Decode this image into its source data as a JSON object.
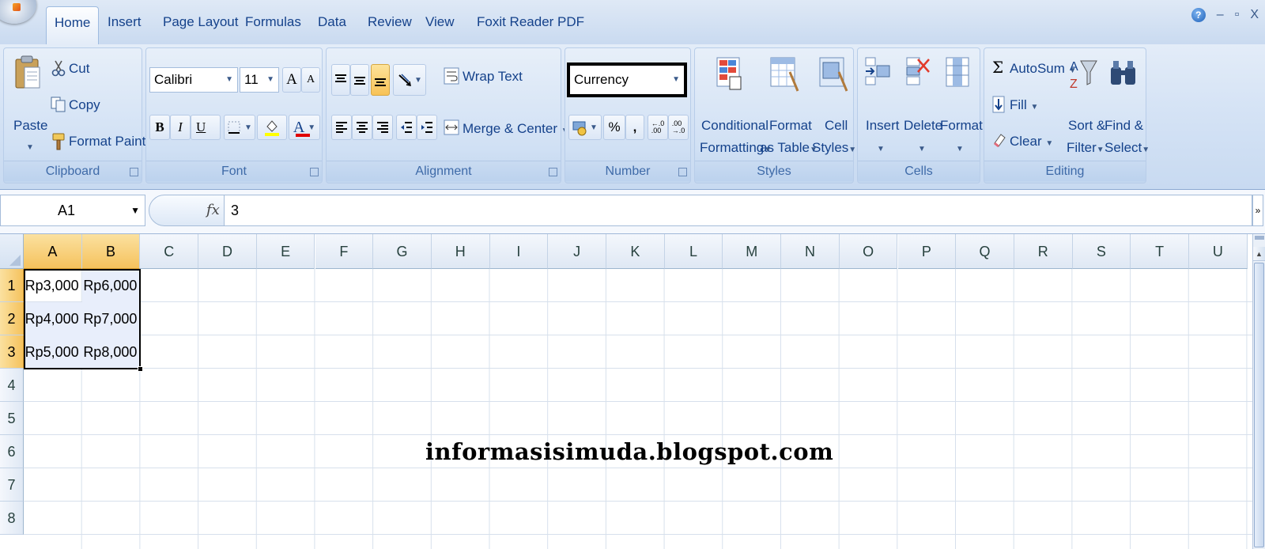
{
  "tabs": [
    {
      "label": "Home",
      "active": true
    },
    {
      "label": "Insert"
    },
    {
      "label": "Page Layout"
    },
    {
      "label": "Formulas"
    },
    {
      "label": "Data"
    },
    {
      "label": "Review"
    },
    {
      "label": "View"
    },
    {
      "label": "Foxit Reader PDF"
    }
  ],
  "window_controls": {
    "help": "?",
    "minimize": "–",
    "restore": "▫",
    "close": "X"
  },
  "clipboard": {
    "group_label": "Clipboard",
    "paste": "Paste",
    "cut": "Cut",
    "copy": "Copy",
    "format_painter": "Format Painter"
  },
  "font": {
    "group_label": "Font",
    "font_name": "Calibri",
    "font_size": "11",
    "grow": "A",
    "shrink": "A",
    "bold": "B",
    "italic": "I",
    "underline": "U",
    "font_color_glyph": "A",
    "fill_color": "#ffff00",
    "font_color": "#e00000"
  },
  "alignment": {
    "group_label": "Alignment",
    "wrap_text": "Wrap Text",
    "merge_center": "Merge & Center"
  },
  "number": {
    "group_label": "Number",
    "format": "Currency",
    "percent": "%",
    "comma": ","
  },
  "styles": {
    "group_label": "Styles",
    "conditional": [
      "Conditional",
      "Formatting"
    ],
    "format_table": [
      "Format",
      "as Table"
    ],
    "cell_styles": [
      "Cell",
      "Styles"
    ]
  },
  "cells_group": {
    "group_label": "Cells",
    "insert": "Insert",
    "delete": "Delete",
    "format": "Format"
  },
  "editing": {
    "group_label": "Editing",
    "autosum": "AutoSum",
    "fill": "Fill",
    "clear": "Clear",
    "sort_filter": [
      "Sort &",
      "Filter"
    ],
    "find_select": [
      "Find &",
      "Select"
    ]
  },
  "formula_bar": {
    "name_box": "A1",
    "fx": "fx",
    "formula": "3"
  },
  "grid": {
    "columns": [
      "A",
      "B",
      "C",
      "D",
      "E",
      "F",
      "G",
      "H",
      "I",
      "J",
      "K",
      "L",
      "M",
      "N",
      "O",
      "P",
      "Q",
      "R",
      "S",
      "T",
      "U"
    ],
    "rows": [
      "1",
      "2",
      "3",
      "4",
      "5",
      "6",
      "7",
      "8"
    ],
    "cells": [
      [
        "Rp3,000",
        "Rp6,000"
      ],
      [
        "Rp4,000",
        "Rp7,000"
      ],
      [
        "Rp5,000",
        "Rp8,000"
      ]
    ],
    "selected_range": "A1:B3"
  },
  "watermark": "informasisimuda.blogspot.com"
}
